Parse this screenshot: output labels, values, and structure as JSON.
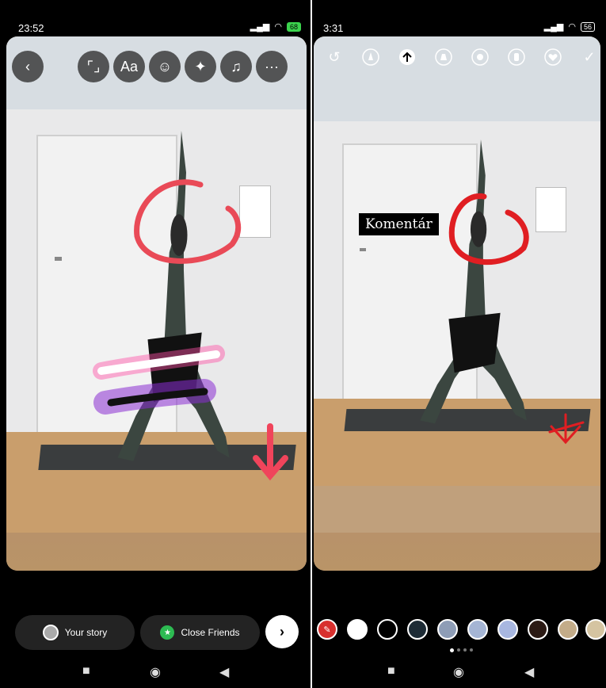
{
  "left": {
    "status": {
      "time": "23:52",
      "battery": "68"
    },
    "toolbar": {
      "back": "‹",
      "crop": "⌜⌟",
      "text": "Aa",
      "sticker": "☺",
      "effects": "✦",
      "music": "♫",
      "more": "···"
    },
    "share": {
      "your_story": "Your story",
      "close_friends": "Close Friends",
      "next": "›"
    }
  },
  "right": {
    "status": {
      "time": "3:31",
      "battery": "56"
    },
    "draw_tools": {
      "undo": "↺",
      "done": "✓"
    },
    "comment_text": "Komentár",
    "swatches": [
      "#d8302e",
      "#ffffff",
      "#000000",
      "#1d2b35",
      "#8e9db6",
      "#a5b5d4",
      "#a8b7e0",
      "#2b1a14",
      "#c3ac89",
      "#d5c4a1"
    ]
  },
  "nav": {
    "square": "■",
    "circle": "◉",
    "back": "◀"
  }
}
